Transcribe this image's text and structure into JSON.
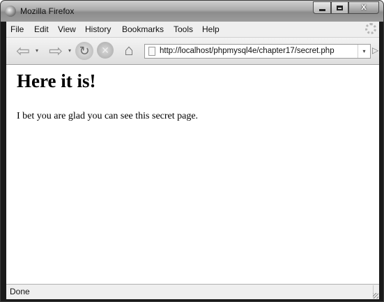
{
  "window": {
    "title": "Mozilla Firefox",
    "icon": "firefox-icon"
  },
  "caption_buttons": {
    "minimize_icon": "minimize-icon",
    "maximize_icon": "maximize-icon",
    "close_label": "X"
  },
  "menu": {
    "items": [
      {
        "label": "File",
        "name": "menu-file"
      },
      {
        "label": "Edit",
        "name": "menu-edit"
      },
      {
        "label": "View",
        "name": "menu-view"
      },
      {
        "label": "History",
        "name": "menu-history"
      },
      {
        "label": "Bookmarks",
        "name": "menu-bookmarks"
      },
      {
        "label": "Tools",
        "name": "menu-tools"
      },
      {
        "label": "Help",
        "name": "menu-help"
      }
    ]
  },
  "navigation": {
    "back_glyph": "⇦",
    "forward_glyph": "⇨",
    "dropdown_glyph": "▾",
    "reload_glyph": "↻",
    "stop_glyph": "✕",
    "home_glyph": "⌂",
    "url": "http://localhost/phpmysql4e/chapter17/secret.php",
    "go_glyph": "▷"
  },
  "page": {
    "heading": "Here it is!",
    "body": "I bet you are glad you can see this secret page."
  },
  "status": {
    "text": "Done"
  }
}
